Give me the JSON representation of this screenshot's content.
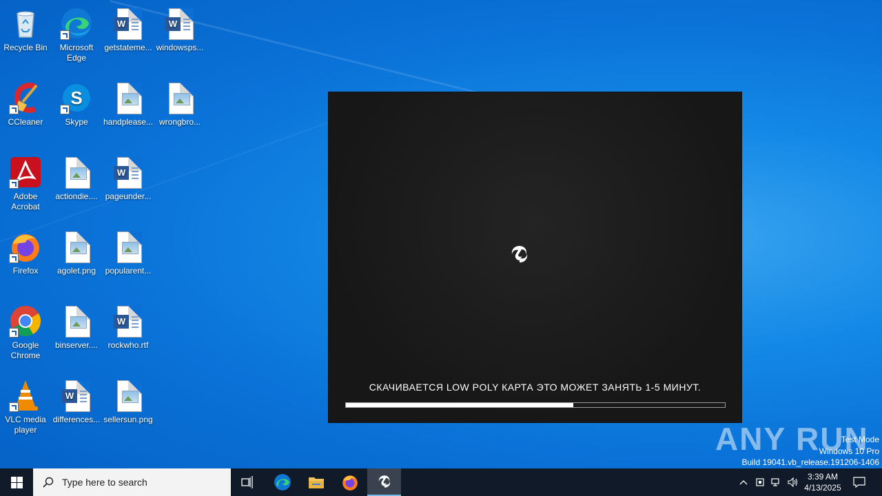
{
  "desktop": {
    "icons": [
      {
        "label": "Recycle Bin"
      },
      {
        "label": "Microsoft Edge"
      },
      {
        "label": "getstateme..."
      },
      {
        "label": "windowsps..."
      },
      {
        "label": "CCleaner"
      },
      {
        "label": "Skype"
      },
      {
        "label": "handplease..."
      },
      {
        "label": "wrongbro..."
      },
      {
        "label": "Adobe Acrobat"
      },
      {
        "label": "actiondie...."
      },
      {
        "label": "pageunder..."
      },
      {
        "label": "Firefox"
      },
      {
        "label": "agolet.png"
      },
      {
        "label": "popularent..."
      },
      {
        "label": "Google Chrome"
      },
      {
        "label": "binserver...."
      },
      {
        "label": "rockwho.rtf"
      },
      {
        "label": "VLC media player"
      },
      {
        "label": "differences..."
      },
      {
        "label": "sellersun.png"
      }
    ]
  },
  "game_window": {
    "loading_text": "СКАЧИВАЕТСЯ LOW POLY КАРТА ЭТО МОЖЕТ ЗАНЯТЬ 1-5 МИНУТ.",
    "progress_fraction": 0.6
  },
  "watermark": {
    "text": "ANY RUN"
  },
  "system_info": {
    "line1": "Test Mode",
    "line2": "Windows 10 Pro",
    "line3": "Build 19041.vb_release.191206-1406"
  },
  "taskbar": {
    "search_placeholder": "Type here to search",
    "time": "3:39 AM",
    "date": "4/13/2025"
  },
  "colors": {
    "taskbar": "#101a28",
    "accent": "#76b9ed"
  }
}
